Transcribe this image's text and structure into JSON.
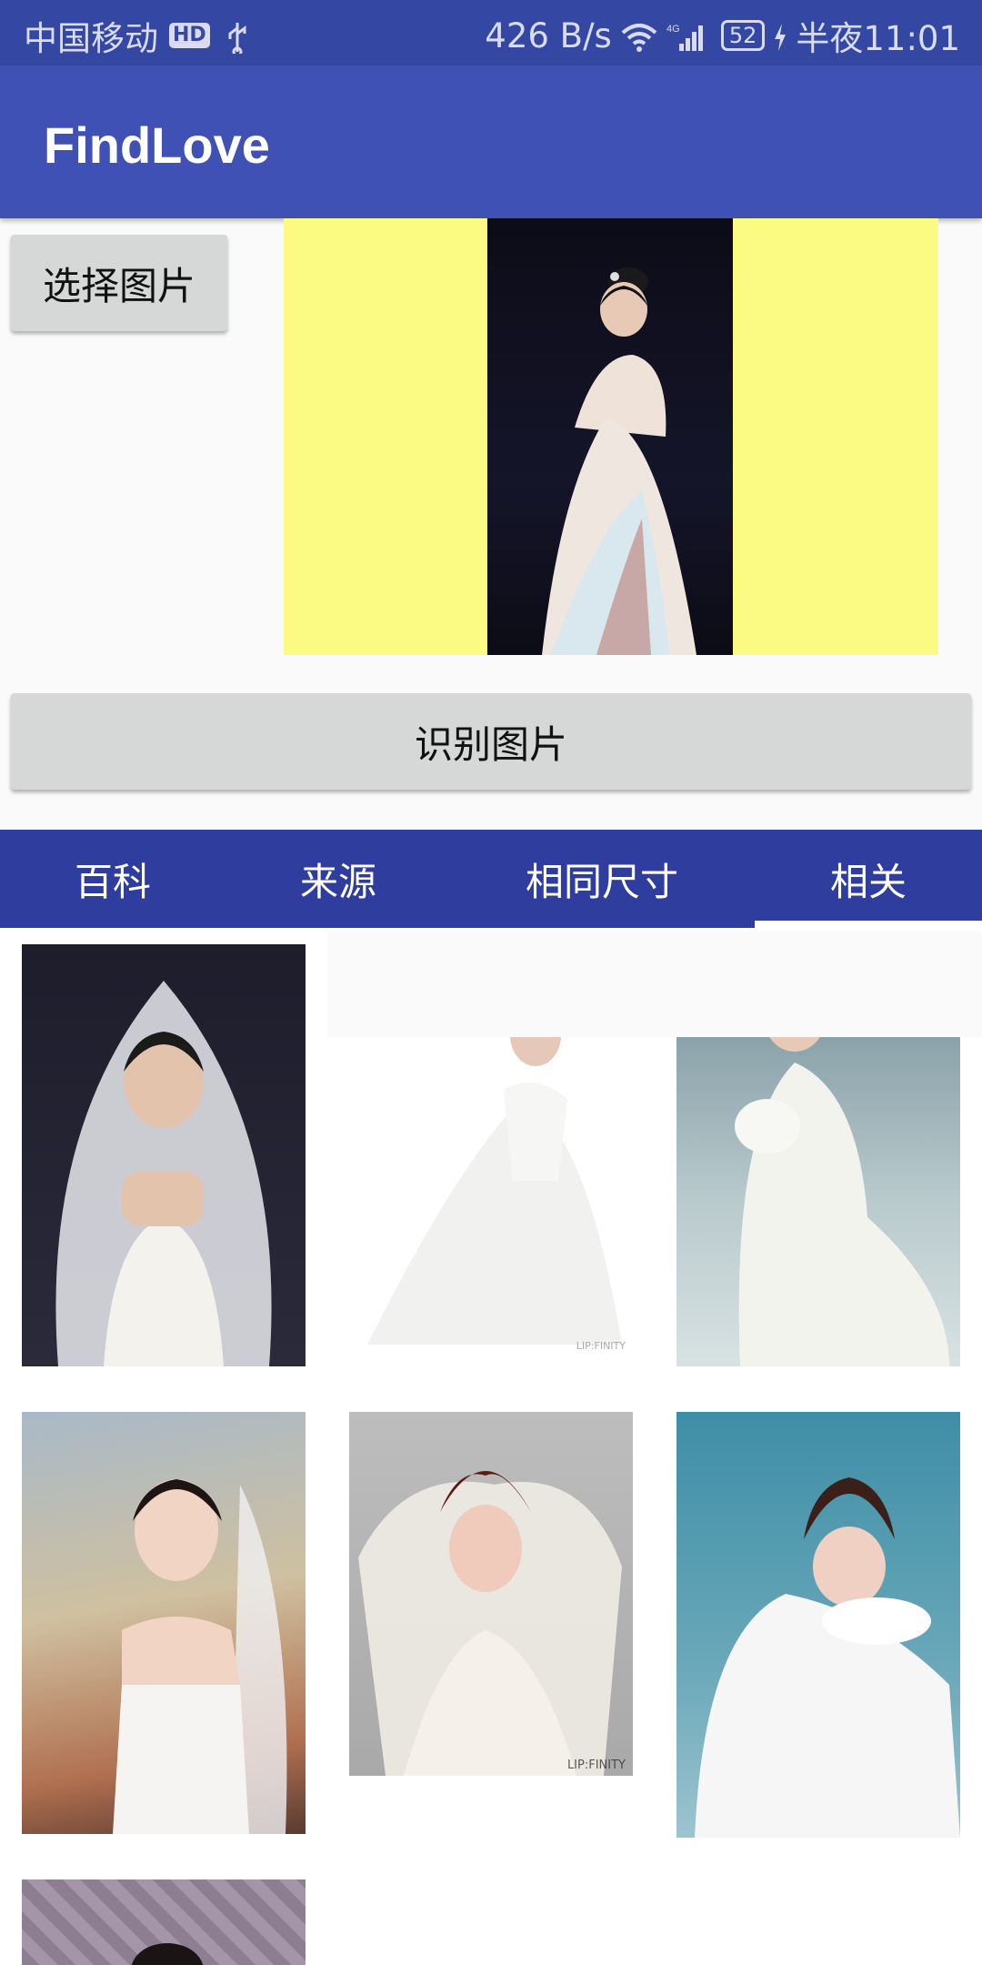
{
  "status_bar": {
    "carrier": "中国移动",
    "hd_badge": "HD",
    "net_speed": "426 B/s",
    "battery_level": "52",
    "time": "半夜11:01"
  },
  "app_bar": {
    "title": "FindLove"
  },
  "buttons": {
    "select_image": "选择图片",
    "recognize_image": "识别图片"
  },
  "tabs": [
    {
      "label": "百科",
      "selected": false
    },
    {
      "label": "来源",
      "selected": false
    },
    {
      "label": "相同尺寸",
      "selected": false
    },
    {
      "label": "相关",
      "selected": true
    }
  ],
  "colors": {
    "primary": "#3f51b5",
    "primary_dark": "#3347a3",
    "tab_bar": "#2f3d9e",
    "preview_bg": "#fbfb84",
    "button": "#d6d7d7"
  },
  "grid_images": [
    {
      "subject": "bride-lace-veil"
    },
    {
      "subject": "bride-white-hat"
    },
    {
      "subject": "bride-lace-dress"
    },
    {
      "subject": "bride-tiara-veil"
    },
    {
      "subject": "woman-lipstick-hood"
    },
    {
      "subject": "bride-white-gloves"
    },
    {
      "subject": "partial-damask-background"
    }
  ],
  "watermarks": {
    "th2": "LIP:FINITY"
  }
}
